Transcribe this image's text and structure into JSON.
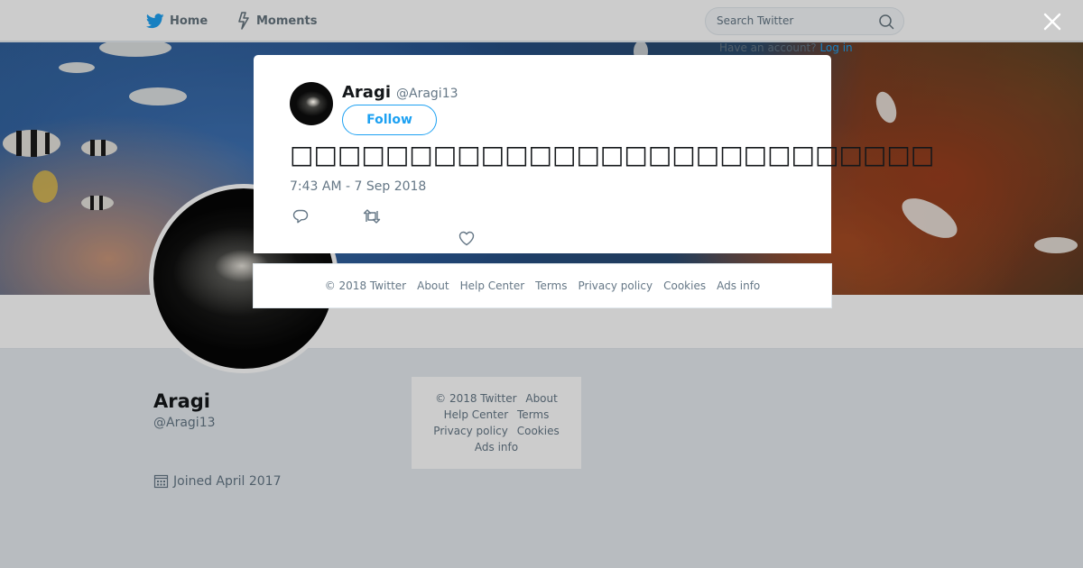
{
  "nav": {
    "home_label": "Home",
    "moments_label": "Moments",
    "search_placeholder": "Search Twitter",
    "login_text": "Have an account?",
    "login_link": "Log in"
  },
  "colors": {
    "brand": "#1da1f2",
    "text_secondary": "#657786",
    "page_bg": "#e6ecf0"
  },
  "profile": {
    "name": "Aragi",
    "handle": "@Aragi13",
    "joined": "Joined April 2017"
  },
  "side_footer": {
    "items": [
      "© 2018 Twitter",
      "About",
      "Help Center",
      "Terms",
      "Privacy policy",
      "Cookies",
      "Ads info"
    ]
  },
  "tweet": {
    "author_name": "Aragi",
    "author_handle": "@Aragi13",
    "follow_label": "Follow",
    "text": "□□□□□□□□□□□□□□□□□□□□□□□□□□□",
    "timestamp": "7:43 AM - 7 Sep 2018"
  },
  "footer": {
    "items": [
      "© 2018 Twitter",
      "About",
      "Help Center",
      "Terms",
      "Privacy policy",
      "Cookies",
      "Ads info"
    ]
  },
  "icons": {
    "home": "twitter-bird-icon",
    "moments": "lightning-icon",
    "search": "search-icon",
    "close": "close-icon",
    "reply": "reply-icon",
    "retweet": "retweet-icon",
    "like": "heart-icon",
    "calendar": "calendar-icon"
  }
}
